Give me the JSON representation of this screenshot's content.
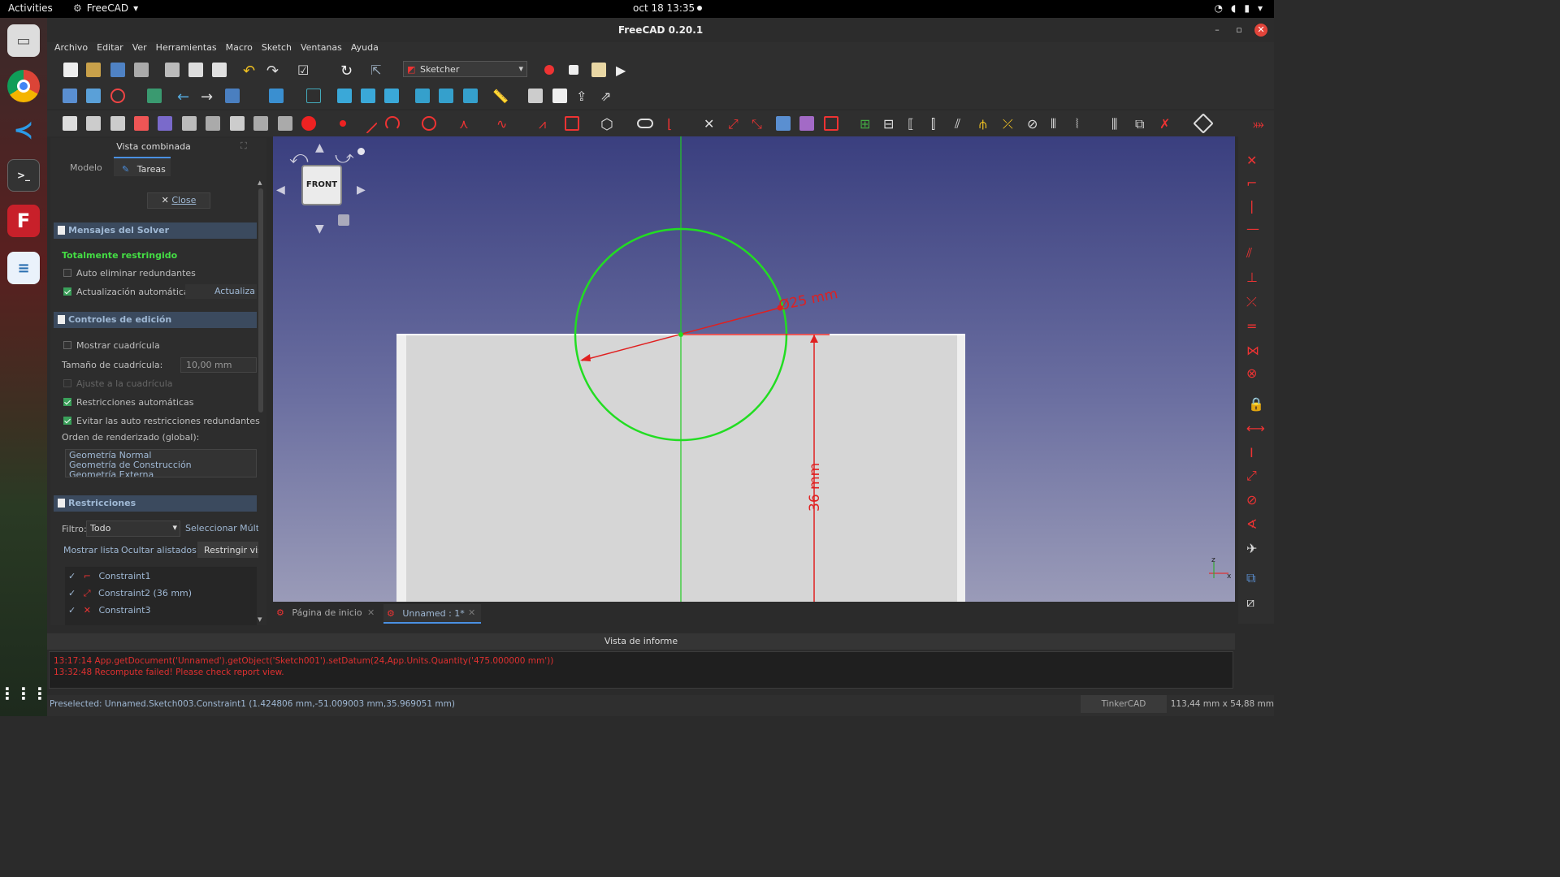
{
  "os": {
    "activities": "Activities",
    "app_name": "FreeCAD",
    "clock": "oct 18  13:35"
  },
  "window": {
    "title": "FreeCAD 0.20.1"
  },
  "menu": [
    "Archivo",
    "Editar",
    "Ver",
    "Herramientas",
    "Macro",
    "Sketch",
    "Ventanas",
    "Ayuda"
  ],
  "workbench": {
    "selected": "Sketcher"
  },
  "combo": {
    "title": "Vista combinada",
    "tabs": [
      "Modelo",
      "Tareas"
    ],
    "close_label": "Close",
    "solver": {
      "header": "Mensajes del Solver",
      "status": "Totalmente restringido",
      "auto_remove": "Auto eliminar redundantes",
      "auto_update": "Actualización automática",
      "update_btn": "Actualiza"
    },
    "edit": {
      "header": "Controles de edición",
      "show_grid": "Mostrar cuadrícula",
      "grid_size_label": "Tamaño de cuadrícula:",
      "grid_size_value": "10,00 mm",
      "snap": "Ajuste a la cuadrícula",
      "auto_constraints": "Restricciones automáticas",
      "avoid_redundant": "Evitar las auto restricciones redundantes",
      "render_order_label": "Orden de renderizado (global):",
      "render_order": [
        "Geometría Normal",
        "Geometría de Construcción",
        "Geometría Externa"
      ]
    },
    "constraints": {
      "header": "Restricciones",
      "filter_label": "Filtro:",
      "filter_value": "Todo",
      "select_multi": "Seleccionar Múlti",
      "show_list": "Mostrar lista",
      "hide_listed": "Ocultar alistados",
      "restrict_vis": "Restringir vis",
      "items": [
        "Constraint1",
        "Constraint2 (36 mm)",
        "Constraint3"
      ]
    }
  },
  "viewport": {
    "navcube_face": "FRONT",
    "dim_radius": "Ø25 mm",
    "dim_height": "36 mm",
    "axis_z": "z",
    "axis_x": "x"
  },
  "doc_tabs": [
    "Página de inicio",
    "Unnamed : 1*"
  ],
  "report": {
    "title": "Vista de informe",
    "lines": [
      "13:17:14  App.getDocument('Unnamed').getObject('Sketch001').setDatum(24,App.Units.Quantity('475.000000 mm'))",
      "13:32:48  Recompute failed! Please check report view."
    ]
  },
  "status": {
    "preselected": "Preselected: Unnamed.Sketch003.Constraint1 (1.424806 mm,-51.009003 mm,35.969051 mm)",
    "nav_style": "TinkerCAD",
    "dimensions": "113,44 mm x 54,88 mm"
  },
  "colors": {
    "accent": "#e03030",
    "sketch_green": "#22dd22",
    "panel_header": "#3b4a5e"
  }
}
